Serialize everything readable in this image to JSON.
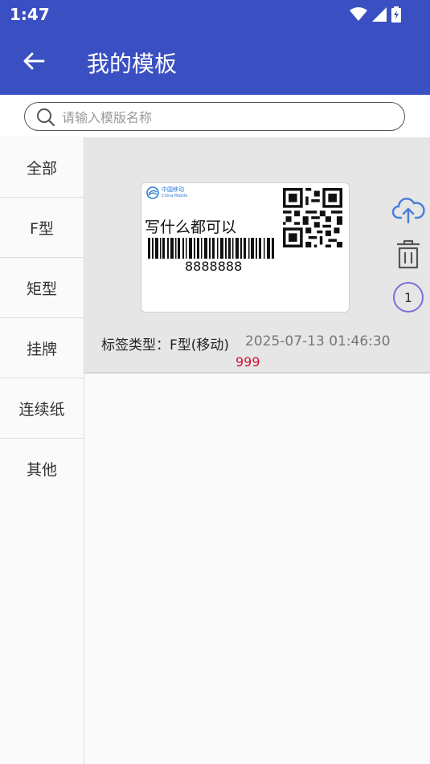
{
  "status_bar": {
    "time": "1:47"
  },
  "header": {
    "title": "我的模板",
    "back_icon": "arrow-left-icon"
  },
  "search": {
    "placeholder": "请输入模版名称",
    "value": ""
  },
  "sidebar": {
    "items": [
      {
        "label": "全部"
      },
      {
        "label": "F型"
      },
      {
        "label": "矩型"
      },
      {
        "label": "挂牌"
      },
      {
        "label": "连续纸"
      },
      {
        "label": "其他"
      }
    ]
  },
  "templates": [
    {
      "preview": {
        "logo_cn": "中国移动",
        "logo_en": "China Mobile",
        "text": "写什么都可以",
        "barcode_value": "8888888"
      },
      "type_label": "标签类型：F型(移动)",
      "timestamp": "2025-07-13 01:46:30",
      "count": "999",
      "badge": "1",
      "actions": [
        "cloud-upload-icon",
        "trash-icon"
      ]
    }
  ],
  "colors": {
    "appbar": "#3a4fc1",
    "accent_count": "#d0103a",
    "badge_border": "#7b6fd6",
    "cloud": "#4a7fd8"
  }
}
